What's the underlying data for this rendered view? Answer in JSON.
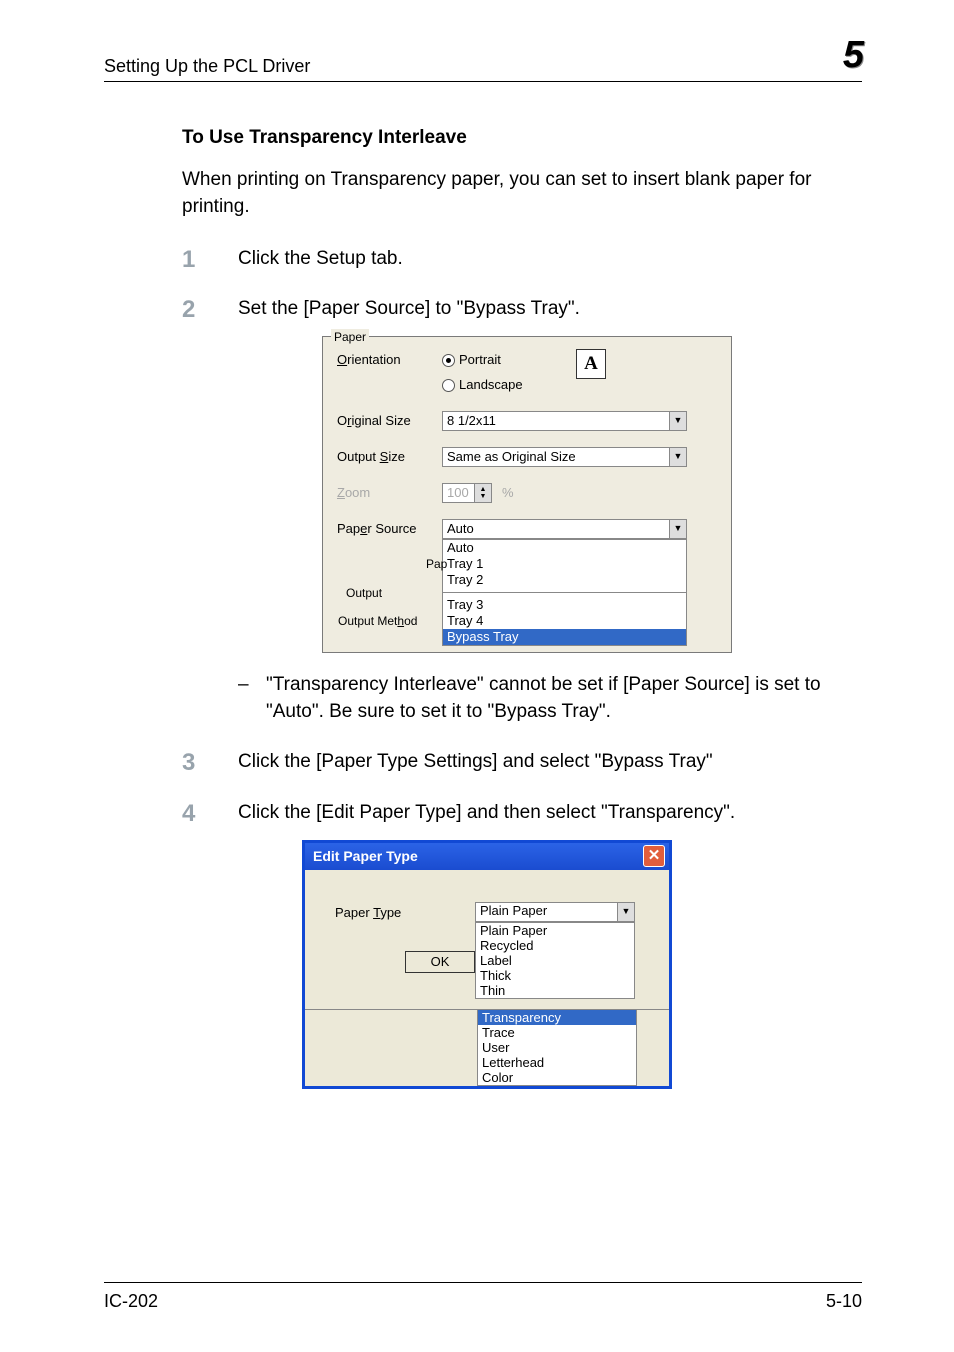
{
  "header": {
    "title": "Setting Up the PCL Driver",
    "chapter": "5"
  },
  "section_title": "To Use Transparency Interleave",
  "intro": "When printing on Transparency paper, you can set to insert blank paper for printing.",
  "steps": {
    "1": "Click the Setup tab.",
    "2": "Set the [Paper Source] to \"Bypass Tray\".",
    "2note": "\"Transparency Interleave\" cannot be set if [Paper Source] is set to \"Auto\". Be sure to set it to \"Bypass Tray\".",
    "3": "Click the [Paper Type Settings] and select \"Bypass Tray\"",
    "4": "Click the [Edit Paper Type] and then select \"Transparency\"."
  },
  "panel1": {
    "group": "Paper",
    "orientation_label": "Orientation",
    "portrait": "Portrait",
    "landscape": "Landscape",
    "original_size_label": "Original Size",
    "original_size_value": "8 1/2x11",
    "output_size_label": "Output Size",
    "output_size_value": "Same as Original Size",
    "zoom_label": "Zoom",
    "zoom_value": "100",
    "zoom_pct": "%",
    "paper_source_label": "Paper Source",
    "paper_source_value": "Auto",
    "pap_label": "Pap",
    "options": [
      "Auto",
      "Tray 1",
      "Tray 2",
      "Tray 3",
      "Tray 4",
      "Bypass Tray"
    ],
    "output_label": "Output",
    "output_method_label": "Output Method"
  },
  "dialog": {
    "title": "Edit Paper Type",
    "paper_type_label": "Paper Type",
    "paper_type_value": "Plain Paper",
    "ok": "OK",
    "options_top": [
      "Plain Paper",
      "Recycled",
      "Label",
      "Thick",
      "Thin"
    ],
    "options_sel": "Transparency",
    "options_bottom": [
      "Trace",
      "User",
      "Letterhead",
      "Color"
    ]
  },
  "footer": {
    "left": "IC-202",
    "right": "5-10"
  }
}
